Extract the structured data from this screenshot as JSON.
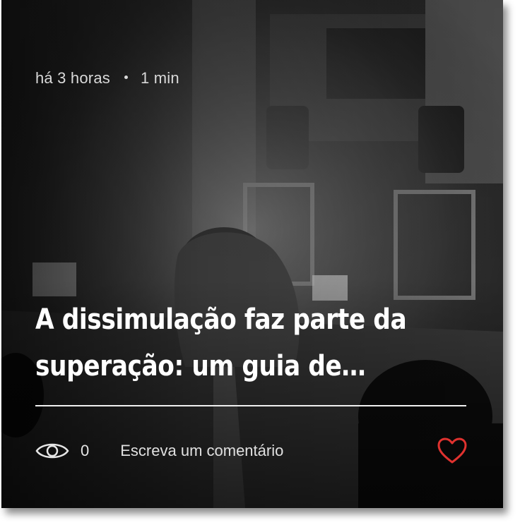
{
  "card": {
    "meta": {
      "time_ago": "há 3 horas",
      "read_time": "1 min"
    },
    "title_line1": "A dissimulação faz parte da",
    "title_line2": "superação: um guia de…",
    "views_count": "0",
    "comment_label": "Escreva um comentário",
    "colors": {
      "heart": "#e0322f",
      "text": "#ffffff",
      "divider": "#f0f0f0"
    },
    "icons": {
      "views": "eye-icon",
      "like": "heart-icon"
    }
  }
}
